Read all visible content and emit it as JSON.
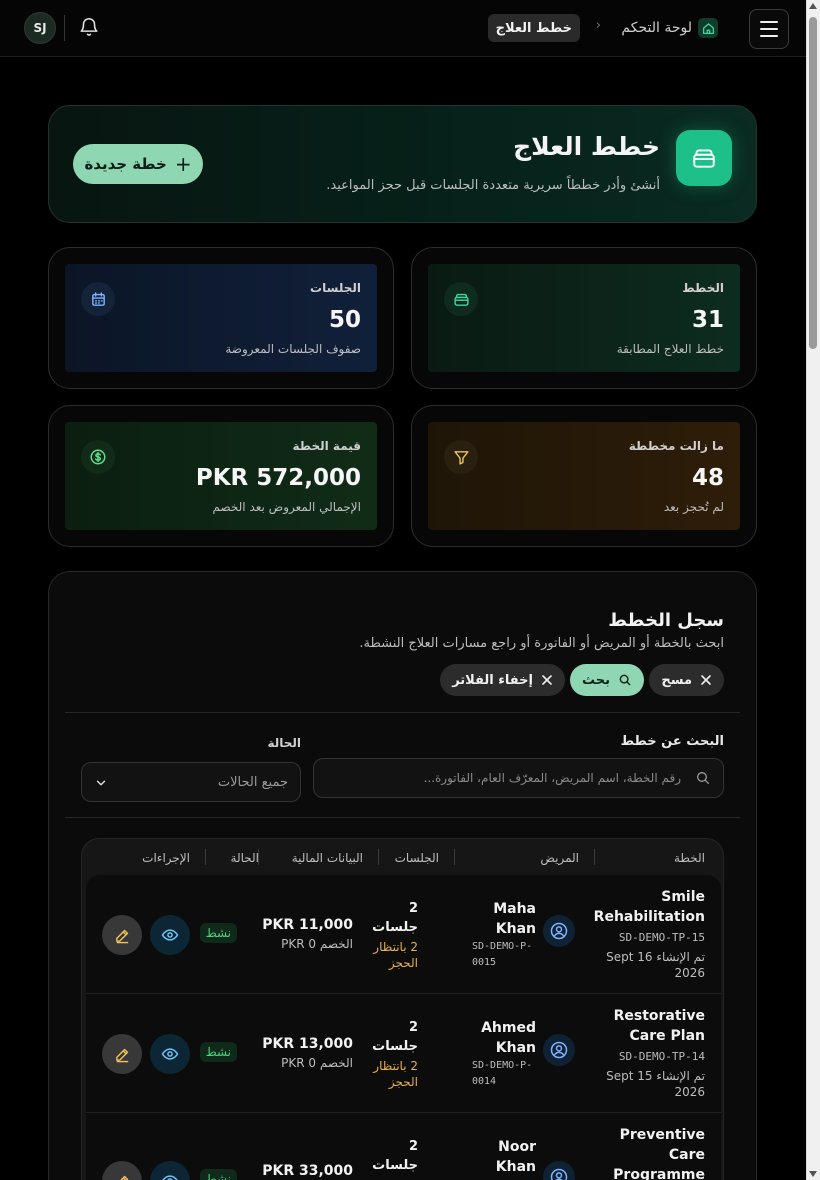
{
  "topbar": {
    "avatar_initials": "SJ",
    "breadcrumb": {
      "home": "لوحة التحكم",
      "current": "خطط العلاج"
    }
  },
  "hero": {
    "title": "خطط العلاج",
    "subtitle": "أنشئ وأدر خططاً سريرية متعددة الجلسات قبل حجز المواعيد.",
    "new_plan_label": "خطة جديدة"
  },
  "stats": {
    "plans": {
      "label": "الخطط",
      "value": "31",
      "sub": "خطط العلاج المطابقة",
      "color": "#0c2a1e"
    },
    "sessions": {
      "label": "الجلسات",
      "value": "50",
      "sub": "صفوف الجلسات المعروضة",
      "color": "#0d1b30"
    },
    "planned": {
      "label": "ما زالت مخططة",
      "value": "48",
      "sub": "لم تُحجز بعد",
      "color": "#2a1a07"
    },
    "value": {
      "label": "قيمة الخطة",
      "value": "PKR 572,000",
      "sub": "الإجمالي المعروض بعد الخصم",
      "color": "#0c2312"
    }
  },
  "register": {
    "title": "سجل الخطط",
    "subtitle": "ابحث بالخطة أو المريض أو الفاتورة أو راجع مسارات العلاج النشطة.",
    "clear_label": "مسح",
    "search_label": "بحث",
    "hide_filters_label": "إخفاء الفلاتر",
    "search_field_label": "البحث عن خطط",
    "search_placeholder": "رقم الخطة، اسم المريض، المعرّف العام، الفاتورة...",
    "status_label": "الحالة",
    "status_value": "جميع الحالات"
  },
  "table": {
    "headers": {
      "plan": "الخطة",
      "patient": "المريض",
      "sessions": "الجلسات",
      "finance": "البيانات المالية",
      "status": "الحالة",
      "actions": "الإجراءات"
    },
    "rows": [
      {
        "plan_name": "Smile Rehabilitation",
        "plan_code": "SD-DEMO-TP-15",
        "created": "تم الإنشاء 16 Sept 2026",
        "patient_name": "Maha Khan",
        "patient_code": "SD-DEMO-P-0015",
        "sessions": "2 جلسات",
        "pending": "2 بانتظار الحجز",
        "total": "PKR 11,000",
        "discount": "الخصم PKR 0",
        "status": "نشط"
      },
      {
        "plan_name": "Restorative Care Plan",
        "plan_code": "SD-DEMO-TP-14",
        "created": "تم الإنشاء 15 Sept 2026",
        "patient_name": "Ahmed Khan",
        "patient_code": "SD-DEMO-P-0014",
        "sessions": "2 جلسات",
        "pending": "2 بانتظار الحجز",
        "total": "PKR 13,000",
        "discount": "الخصم PKR 0",
        "status": "نشط"
      },
      {
        "plan_name": "Preventive Care Programme",
        "plan_code": "",
        "created": "",
        "patient_name": "Noor Khan",
        "patient_code": "",
        "sessions": "2 جلسات",
        "pending": "",
        "total": "PKR 33,000",
        "discount": "",
        "status": "نشط"
      }
    ]
  },
  "colors": {
    "accent": "#8fd6b2",
    "accent_strong": "#1ec08a",
    "active": "#4cd07d",
    "pending": "#e8b04a"
  }
}
